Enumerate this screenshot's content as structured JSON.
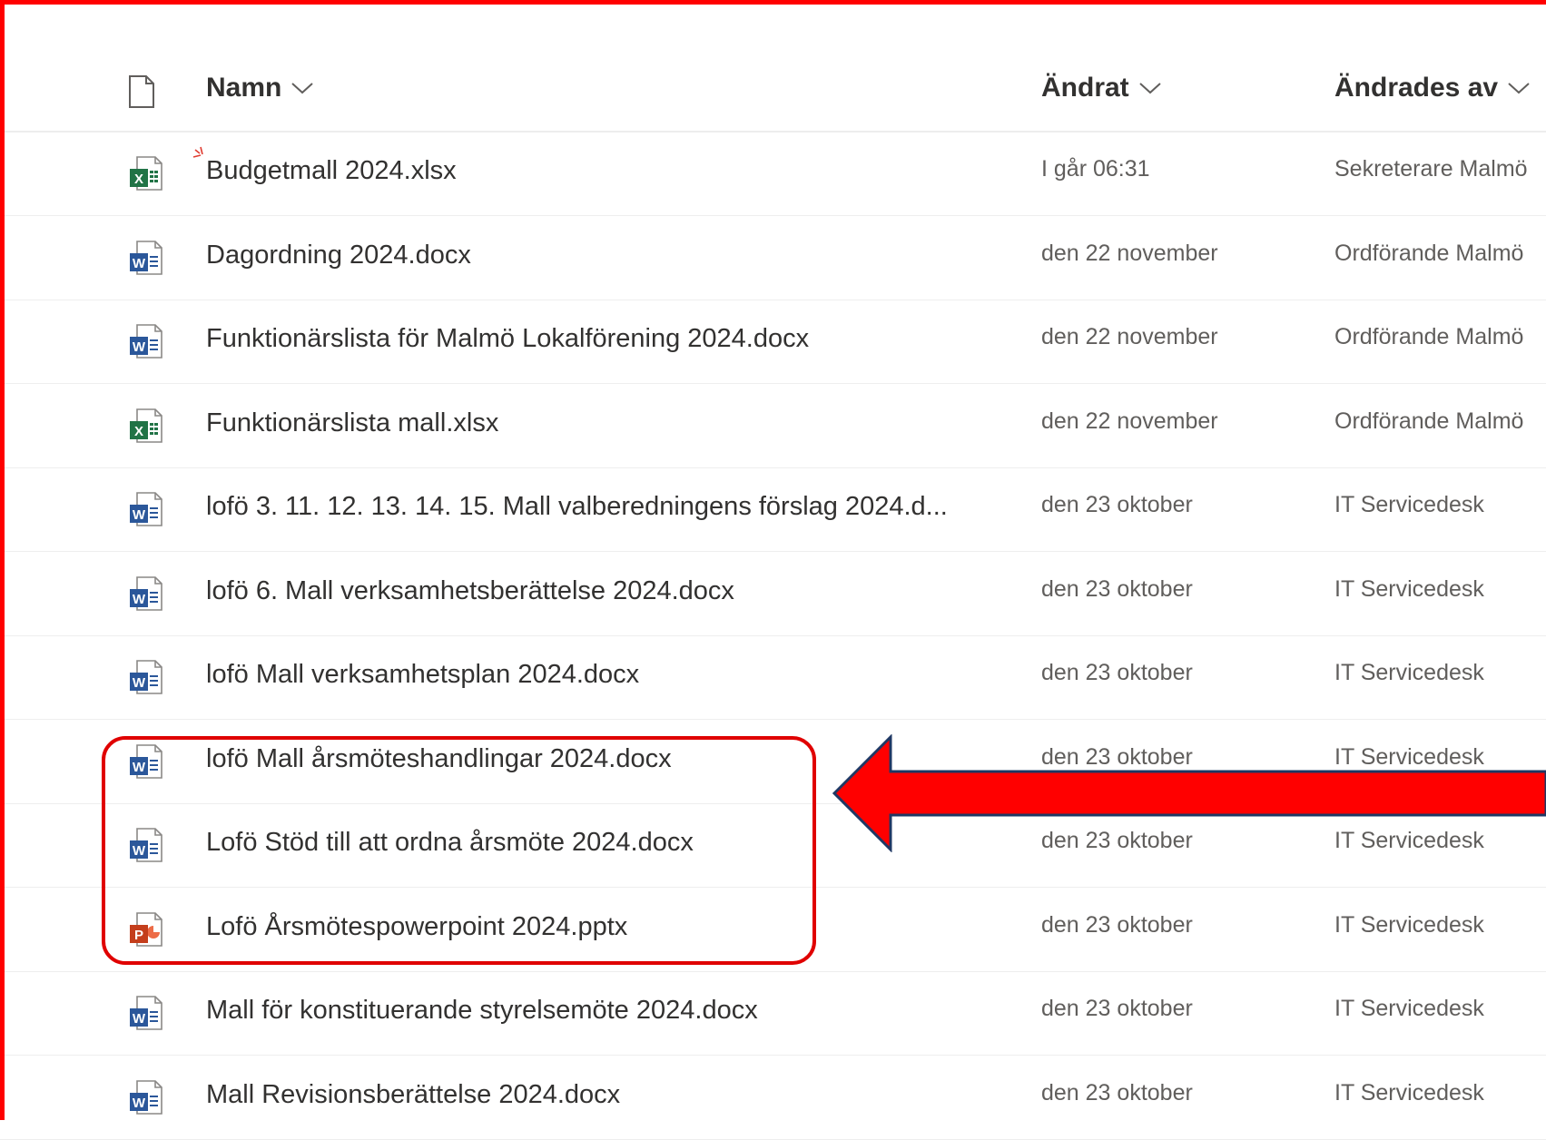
{
  "header": {
    "name_label": "Namn",
    "modified_label": "Ändrat",
    "modified_by_label": "Ändrades av"
  },
  "files": [
    {
      "name": "Budgetmall 2024.xlsx",
      "type": "xlsx",
      "modified": "I går 06:31",
      "modified_by": "Sekreterare Malmö",
      "is_new": true
    },
    {
      "name": "Dagordning 2024.docx",
      "type": "docx",
      "modified": "den 22 november",
      "modified_by": "Ordförande Malmö"
    },
    {
      "name": "Funktionärslista för Malmö Lokalförening 2024.docx",
      "type": "docx",
      "modified": "den 22 november",
      "modified_by": "Ordförande Malmö"
    },
    {
      "name": "Funktionärslista mall.xlsx",
      "type": "xlsx",
      "modified": "den 22 november",
      "modified_by": "Ordförande Malmö"
    },
    {
      "name": "lofö 3. 11. 12. 13. 14. 15. Mall valberedningens förslag 2024.d...",
      "type": "docx",
      "modified": "den 23 oktober",
      "modified_by": "IT Servicedesk"
    },
    {
      "name": "lofö 6. Mall verksamhetsberättelse 2024.docx",
      "type": "docx",
      "modified": "den 23 oktober",
      "modified_by": "IT Servicedesk"
    },
    {
      "name": "lofö Mall verksamhetsplan 2024.docx",
      "type": "docx",
      "modified": "den 23 oktober",
      "modified_by": "IT Servicedesk"
    },
    {
      "name": "lofö Mall årsmöteshandlingar 2024.docx",
      "type": "docx",
      "modified": "den 23 oktober",
      "modified_by": "IT Servicedesk"
    },
    {
      "name": "Lofö Stöd till att ordna årsmöte 2024.docx",
      "type": "docx",
      "modified": "den 23 oktober",
      "modified_by": "IT Servicedesk"
    },
    {
      "name": "Lofö Årsmötespowerpoint 2024.pptx",
      "type": "pptx",
      "modified": "den 23 oktober",
      "modified_by": "IT Servicedesk"
    },
    {
      "name": "Mall för konstituerande styrelsemöte 2024.docx",
      "type": "docx",
      "modified": "den 23 oktober",
      "modified_by": "IT Servicedesk"
    },
    {
      "name": "Mall Revisionsberättelse 2024.docx",
      "type": "docx",
      "modified": "den 23 oktober",
      "modified_by": "IT Servicedesk"
    }
  ],
  "icons": {
    "docx": "word-file-icon",
    "xlsx": "excel-file-icon",
    "pptx": "powerpoint-file-icon",
    "header": "document-icon",
    "sort": "chevron-down-icon"
  },
  "colors": {
    "word": "#2b579a",
    "excel": "#217346",
    "powerpoint": "#c43e1c",
    "annotation": "#ff0000"
  }
}
